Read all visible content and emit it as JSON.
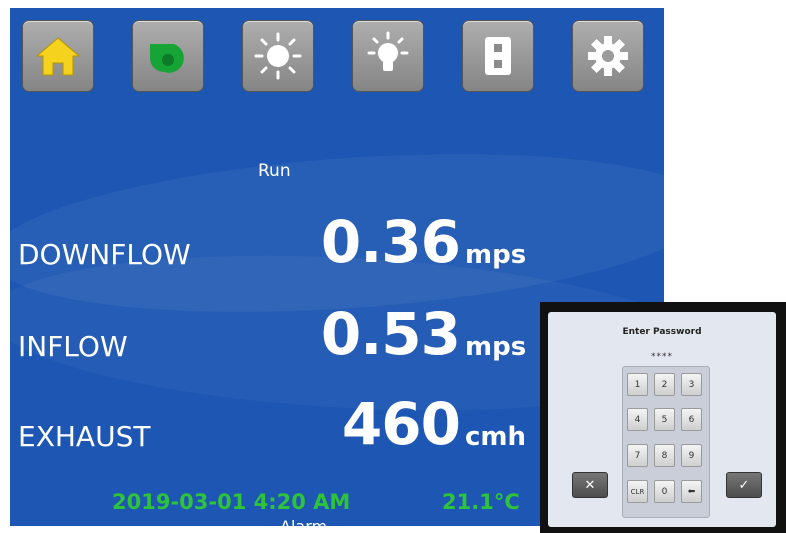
{
  "toolbar": {
    "buttons": [
      {
        "name": "home",
        "icon": "home-icon",
        "color": "#f5d21e"
      },
      {
        "name": "blower",
        "icon": "blower-icon",
        "color": "#16a437"
      },
      {
        "name": "uv-light",
        "icon": "sun-icon",
        "color": "#ffffff"
      },
      {
        "name": "light",
        "icon": "lightbulb-icon",
        "color": "#ffffff"
      },
      {
        "name": "outlet",
        "icon": "outlet-icon",
        "color": "#ffffff"
      },
      {
        "name": "settings",
        "icon": "gear-icon",
        "color": "#ffffff"
      }
    ]
  },
  "status": "Run",
  "readings": [
    {
      "label": "DOWNFLOW",
      "value": "0.36",
      "unit": "mps"
    },
    {
      "label": "INFLOW",
      "value": "0.53",
      "unit": "mps"
    },
    {
      "label": "EXHAUST",
      "value": "460",
      "unit": "cmh"
    }
  ],
  "footer": {
    "datetime": "2019-03-01 4:20 AM",
    "temperature": "21.1°C",
    "below_text": "Alarm"
  },
  "password_dialog": {
    "title": "Enter Password",
    "masked_value": "****",
    "keys": [
      "1",
      "2",
      "3",
      "4",
      "5",
      "6",
      "7",
      "8",
      "9",
      "CLR",
      "0",
      "⬅"
    ],
    "cancel_label": "✕",
    "ok_label": "✓"
  },
  "colors": {
    "screen_background": "#1d57b3",
    "footer_text": "#2fc23b",
    "button_face": "#9a9a9a"
  }
}
